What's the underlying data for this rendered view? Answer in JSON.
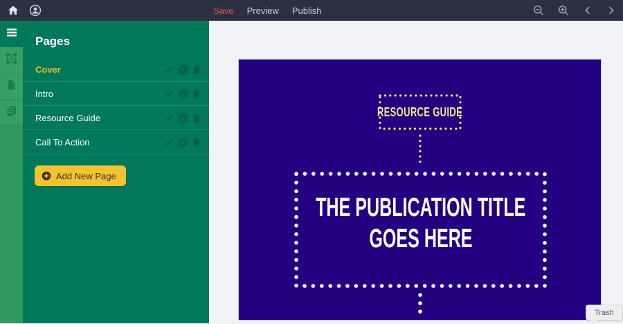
{
  "topbar": {
    "save_label": "Save",
    "preview_label": "Preview",
    "publish_label": "Publish"
  },
  "pages_panel": {
    "title": "Pages",
    "pages": [
      {
        "label": "Cover",
        "selected": true
      },
      {
        "label": "Intro",
        "selected": false
      },
      {
        "label": "Resource Guide",
        "selected": false
      },
      {
        "label": "Call To Action",
        "selected": false
      }
    ],
    "add_button_label": "Add New Page"
  },
  "document_page": {
    "badge_text": "RESOURCE GUIDE",
    "title_line1": "THE PUBLICATION TITLE",
    "title_line2": "GOES HERE"
  },
  "canvas": {
    "tooltip_label": "Trash"
  },
  "colors": {
    "topbar_bg": "#2b3140",
    "save_red": "#e1524a",
    "panel_green": "#00795a",
    "rail_green": "#2f9a5b",
    "accent_yellow": "#f2c230",
    "page_purple": "#220080",
    "pale_yellow": "#f0e88f",
    "canvas_gray": "#f1f2f5"
  }
}
